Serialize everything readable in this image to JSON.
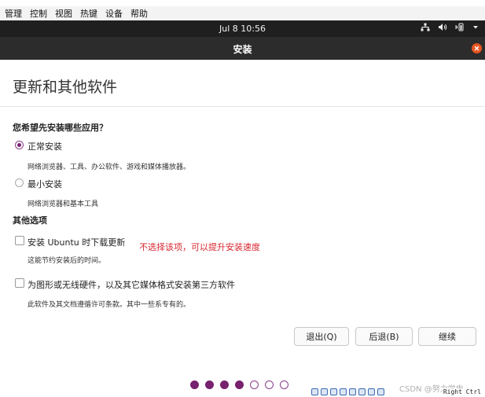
{
  "host": {
    "menu": [
      "管理",
      "控制",
      "视图",
      "热键",
      "设备",
      "帮助"
    ]
  },
  "topbar": {
    "clock": "Jul 8  10:56"
  },
  "window": {
    "title": "安装"
  },
  "page": {
    "title": "更新和其他软件",
    "question": "您希望先安装哪些应用？",
    "install_type": [
      {
        "label": "正常安装",
        "description": "网络浏览器、工具、办公软件、游戏和媒体播放器。",
        "selected": true
      },
      {
        "label": "最小安装",
        "description": "网络浏览器和基本工具",
        "selected": false
      }
    ],
    "other_options_title": "其他选项",
    "options": [
      {
        "label": "安装 Ubuntu 时下载更新",
        "description": "这能节约安装后的时间。",
        "checked": false
      },
      {
        "label": "为图形或无线硬件，以及其它媒体格式安装第三方软件",
        "description": "此软件及其文档遵循许可条款。其中一些系专有的。",
        "checked": false
      }
    ],
    "annotation": "不选择该项，可以提升安装速度"
  },
  "buttons": {
    "quit": "退出(Q)",
    "back": "后退(B)",
    "continue": "继续"
  },
  "progress": {
    "current_step": 4,
    "total_steps": 7
  },
  "statusbar": {
    "watermark": "CSDN @努力学电···",
    "host_key": "Right Ctrl"
  },
  "colors": {
    "accent": "#77216f",
    "close": "#e95420",
    "annotation": "#d8262f",
    "topbar": "#1f1f1f",
    "header": "#2c2c2c"
  }
}
